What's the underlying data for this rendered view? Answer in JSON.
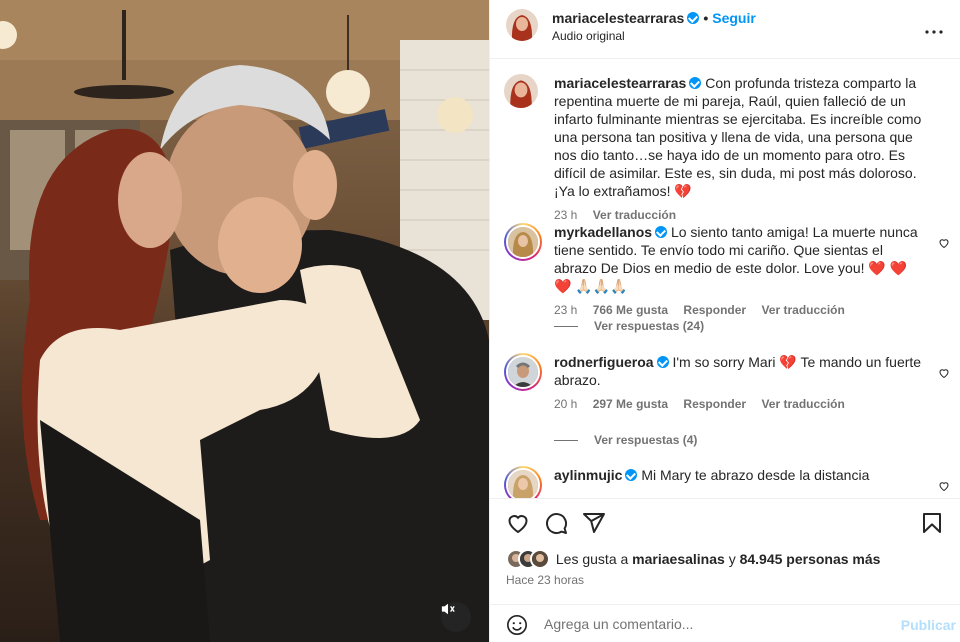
{
  "post": {
    "username": "mariacelestearraras",
    "follow_label": "Seguir",
    "audio_label": "Audio original",
    "caption": "Con profunda tristeza comparto la repentina muerte de mi pareja, Raúl, quien falleció de un infarto fulminante mientras se ejercitaba. Es increíble como una persona tan positiva y llena de vida, una persona que nos dio tanto…se haya ido de un momento para otro. Es difícil de asimilar. Este es, sin duda, mi post más doloroso. ¡Ya lo extrañamos! 💔",
    "caption_time": "23 h",
    "caption_translate": "Ver traducción"
  },
  "comments": [
    {
      "username": "myrkadellanos",
      "text": "Lo siento tanto amiga! La muerte nunca tiene sentido. Te envío todo mi cariño. Que sientas el abrazo De Dios en medio de este dolor. Love you! ❤️ ❤️ ❤️ 🙏🏻🙏🏻🙏🏻",
      "time": "23 h",
      "likes": "766 Me gusta",
      "reply": "Responder",
      "translate": "Ver traducción",
      "replies": "Ver respuestas (24)"
    },
    {
      "username": "rodnerfigueroa",
      "text": "I'm so sorry Mari 💔 Te mando un fuerte abrazo.",
      "time": "20 h",
      "likes": "297 Me gusta",
      "reply": "Responder",
      "translate": "Ver traducción",
      "replies": "Ver respuestas (4)"
    },
    {
      "username": "aylinmujic",
      "text": "Mi Mary te abrazo desde la distancia"
    }
  ],
  "likes_bar": {
    "prefix": "Les gusta a",
    "liker": "mariaesalinas",
    "conj": "y",
    "others": "84.945 personas más"
  },
  "time_ago": "Hace 23 horas",
  "add_comment": {
    "placeholder": "Agrega un comentario...",
    "publish": "Publicar"
  },
  "icons": {
    "more": "more-horizontal-icon",
    "like": "heart-icon",
    "comment": "comment-icon",
    "share": "share-icon",
    "save": "bookmark-icon",
    "emoji": "emoji-icon",
    "mute": "speaker-muted-icon"
  },
  "colors": {
    "link": "#0095f6",
    "muted": "#737373",
    "text": "#262626",
    "publish_disabled": "#b3dffc"
  }
}
